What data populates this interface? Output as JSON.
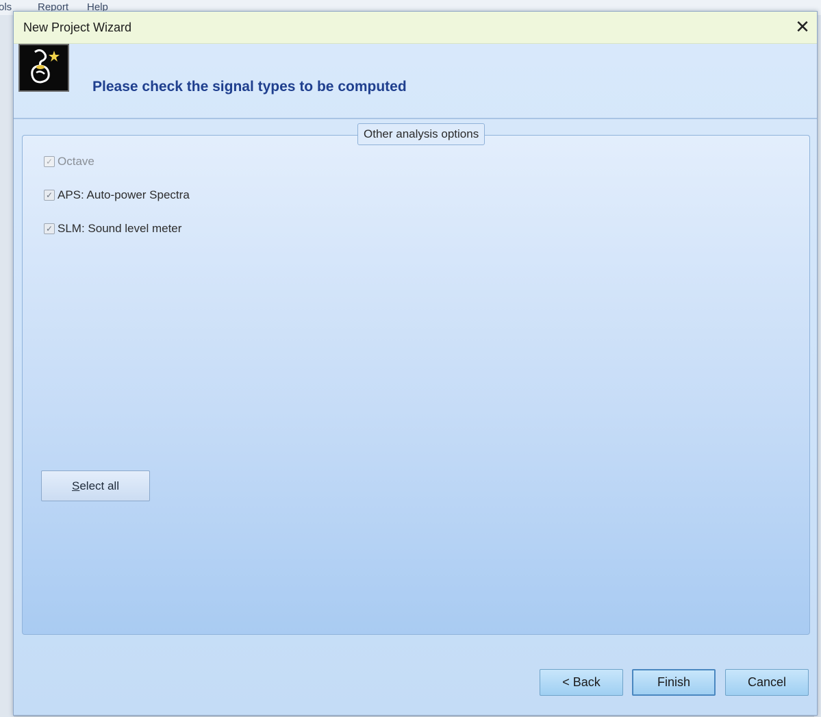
{
  "background_app": {
    "menu": [
      "ols",
      "Report",
      "Help"
    ]
  },
  "dialog": {
    "title": "New Project Wizard",
    "close_icon": "close-icon",
    "logo_icon": "wizard-icon",
    "header_title": "Please check the signal types to be computed",
    "group": {
      "legend": "Other analysis options",
      "options": [
        {
          "label": "Octave",
          "checked": true,
          "enabled": false
        },
        {
          "label": "APS: Auto-power Spectra",
          "checked": true,
          "enabled": true
        },
        {
          "label": "SLM: Sound level meter",
          "checked": true,
          "enabled": true
        }
      ],
      "select_all": {
        "mnemonic": "S",
        "rest": "elect all"
      }
    },
    "buttons": {
      "back": "< Back",
      "finish": "Finish",
      "cancel": "Cancel"
    }
  }
}
